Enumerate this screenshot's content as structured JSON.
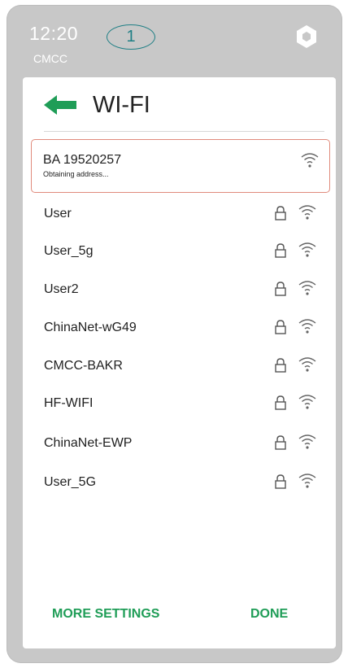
{
  "status": {
    "time": "12:20",
    "carrier": "CMCC"
  },
  "callout": "1",
  "header": {
    "title": "WI-FI"
  },
  "selected_network": {
    "name": "BA 19520257",
    "status": "Obtaining address..."
  },
  "networks": [
    {
      "name": "User"
    },
    {
      "name": "User_5g"
    },
    {
      "name": "User2"
    },
    {
      "name": "ChinaNet-wG49"
    },
    {
      "name": "CMCC-BAKR"
    },
    {
      "name": "HF-WIFI"
    },
    {
      "name": "ChinaNet-EWP"
    },
    {
      "name": "User_5G"
    }
  ],
  "footer": {
    "more_settings": "MORE SETTINGS",
    "done": "DONE"
  },
  "colors": {
    "accent": "#1f9d57",
    "selected_border": "#e08b7c",
    "frame": "#c8c8c8",
    "callout": "#1f7f85"
  },
  "icons": {
    "lock": "lock-icon",
    "wifi": "wifi-icon",
    "back": "back-arrow-icon",
    "home": "hexagon-icon"
  }
}
